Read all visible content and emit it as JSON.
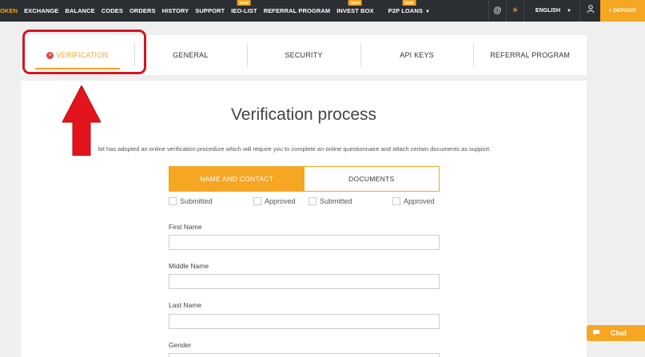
{
  "nav": {
    "items": [
      {
        "label": "OKEN",
        "badge": ""
      },
      {
        "label": "EXCHANGE",
        "badge": ""
      },
      {
        "label": "BALANCE",
        "badge": ""
      },
      {
        "label": "CODES",
        "badge": ""
      },
      {
        "label": "ORDERS",
        "badge": ""
      },
      {
        "label": "HISTORY",
        "badge": ""
      },
      {
        "label": "SUPPORT",
        "badge": ""
      },
      {
        "label": "IEO-LIST",
        "badge": "NEW"
      },
      {
        "label": "REFERRAL PROGRAM",
        "badge": ""
      },
      {
        "label": "INVEST BOX",
        "badge": "NEW"
      },
      {
        "label": "P2P LOANS",
        "badge": "NEW"
      }
    ],
    "language": "ENGLISH",
    "deposit_label": "+ DEPOSIT"
  },
  "tabs": [
    {
      "label": "VERIFICATION"
    },
    {
      "label": "GENERAL"
    },
    {
      "label": "SECURITY"
    },
    {
      "label": "API KEYS"
    },
    {
      "label": "REFERRAL PROGRAM"
    }
  ],
  "main": {
    "title": "Verification process",
    "intro": "bit has adopted an online verification procedure which will require you to complete an online questionnaire and attach certain documents as support.",
    "steps": [
      {
        "label": "NAME AND CONTACT"
      },
      {
        "label": "DOCUMENTS"
      }
    ],
    "statuses": [
      {
        "label": "Submitted"
      },
      {
        "label": "Approved"
      },
      {
        "label": "Submitted"
      },
      {
        "label": "Approved"
      }
    ],
    "fields": [
      {
        "label": "First Name",
        "value": ""
      },
      {
        "label": "Middle Name",
        "value": ""
      },
      {
        "label": "Last Name",
        "value": ""
      },
      {
        "label": "Gender",
        "value": ""
      }
    ]
  },
  "chat": {
    "label": "Chat"
  },
  "colors": {
    "accent": "#f5a623",
    "nav_bg": "#2b2f33",
    "annotation": "#d9121f"
  },
  "icons": [
    "at-sign-icon",
    "sun-icon",
    "user-icon",
    "close-circle-icon",
    "chat-bubble-icon",
    "red-arrow-annotation"
  ]
}
